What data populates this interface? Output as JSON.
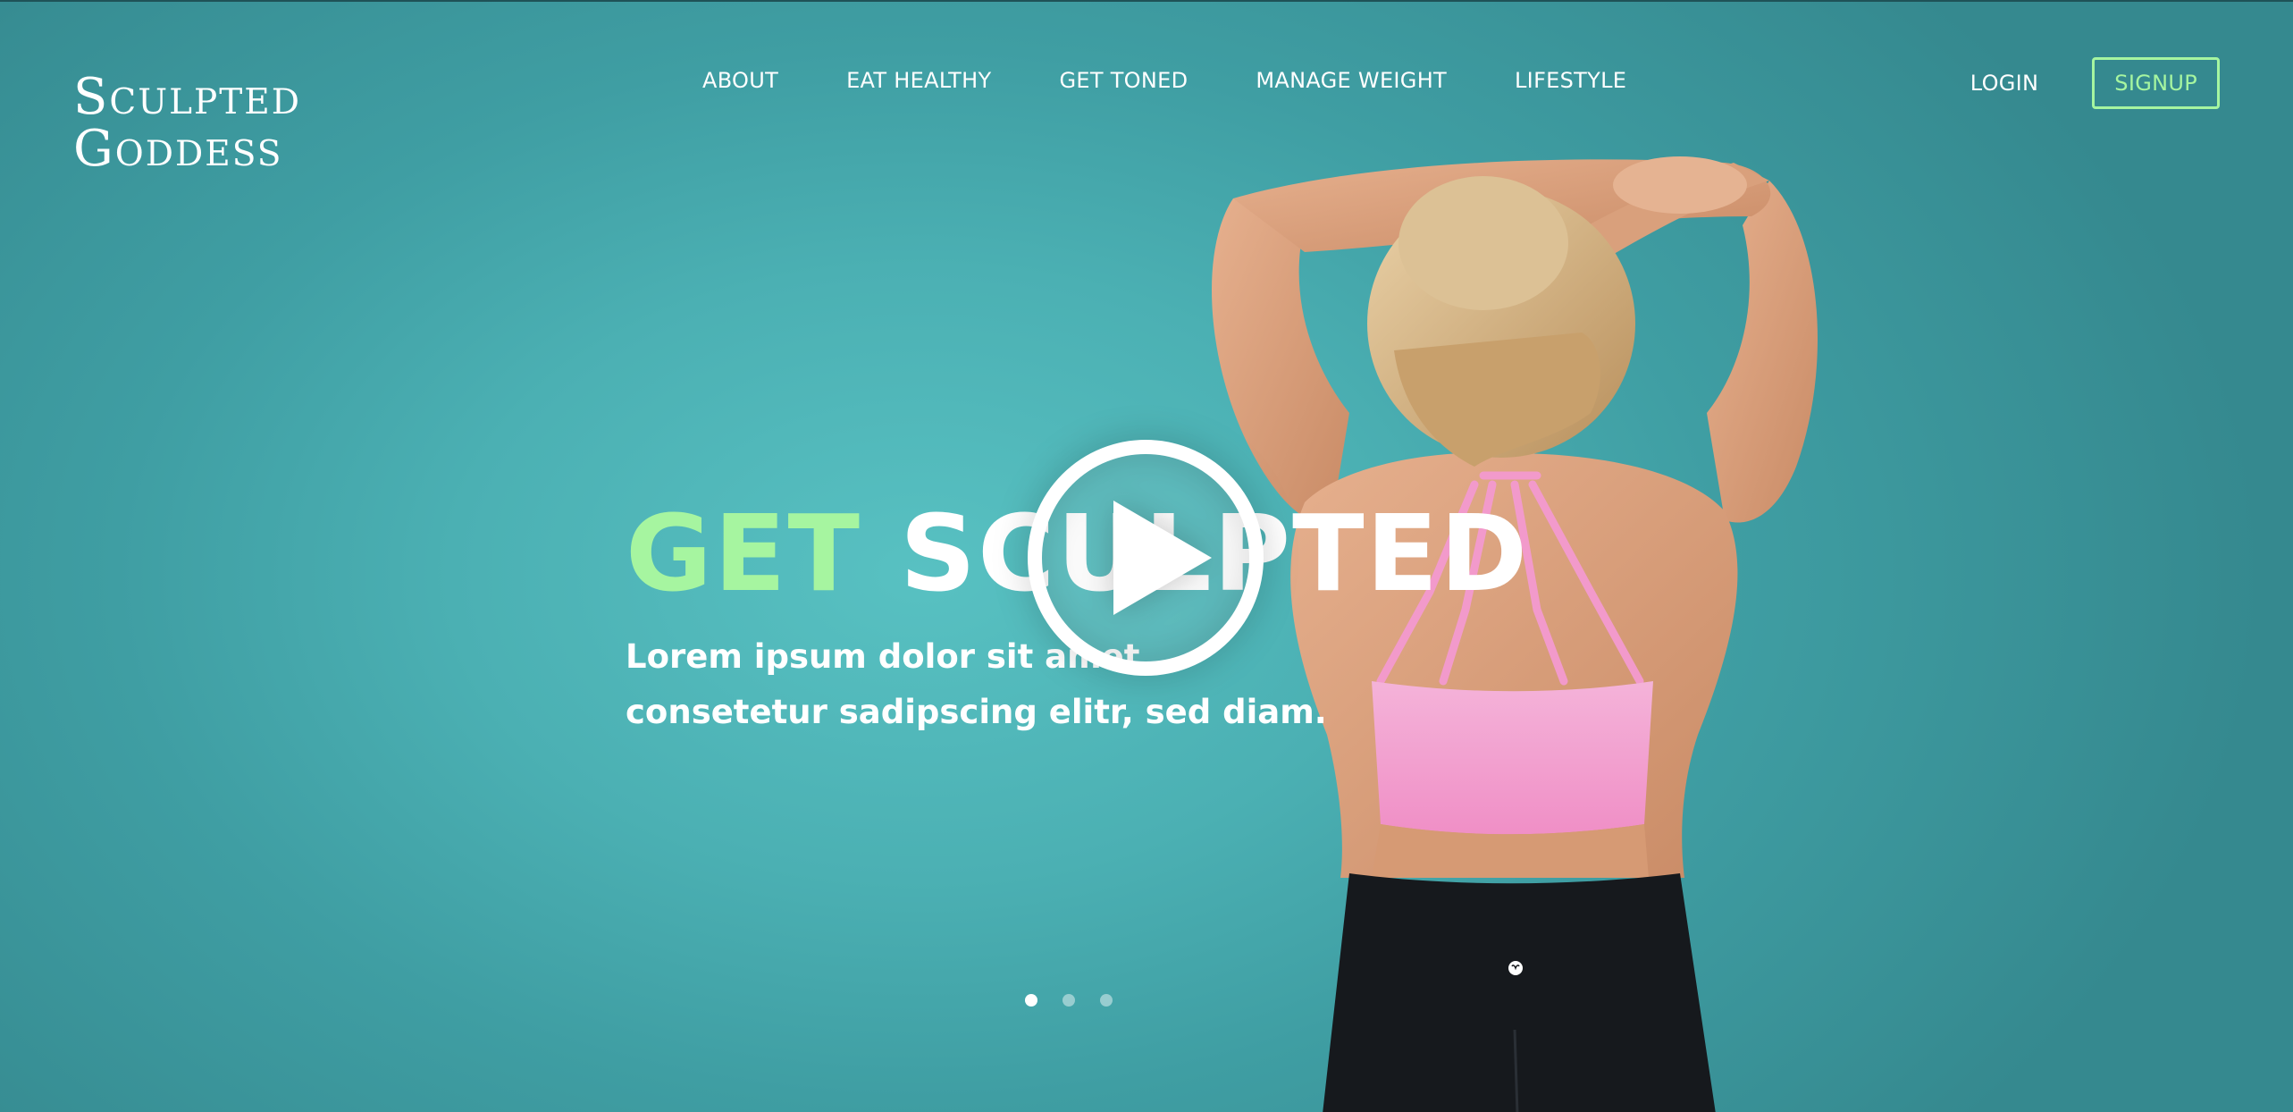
{
  "brand": {
    "line1": "Sculpted",
    "line2": "Goddess"
  },
  "nav": {
    "items": [
      {
        "label": "ABOUT"
      },
      {
        "label": "EAT HEALTHY"
      },
      {
        "label": "GET TONED"
      },
      {
        "label": "MANAGE WEIGHT"
      },
      {
        "label": "LIFESTYLE"
      }
    ]
  },
  "auth": {
    "login_label": "LOGIN",
    "signup_label": "SIGNUP"
  },
  "hero": {
    "title_accent": "GET",
    "title_rest": "SCULPTED",
    "subtitle_line1": "Lorem ipsum dolor sit amet,",
    "subtitle_line2": "consetetur sadipscing elitr, sed diam."
  },
  "carousel": {
    "slide_count": 3,
    "active_index": 0
  },
  "colors": {
    "accent_green": "#a6f5a0",
    "background_teal": "#4bb0b3",
    "top_color": "#f7a6d4",
    "bottom_color": "#15181c"
  },
  "icons": {
    "play": "play-icon",
    "leggings_logo": "brand-logo-icon"
  }
}
